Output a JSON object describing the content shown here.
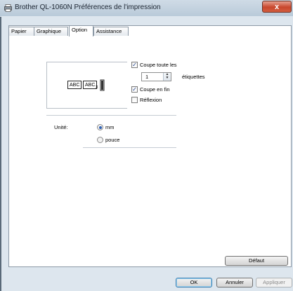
{
  "window": {
    "title": "Brother QL-1060N Préférences de l'impression",
    "close_label": "x"
  },
  "tabs": [
    {
      "label": "Papier",
      "active": false
    },
    {
      "label": "Graphique",
      "active": false
    },
    {
      "label": "Option",
      "active": true
    },
    {
      "label": "Assistance",
      "active": false
    }
  ],
  "preview": {
    "label_1": "ABC",
    "label_2": "ABC",
    "cut_mark": "x"
  },
  "options": {
    "cut_every": {
      "label": "Coupe toute les",
      "checked": true
    },
    "cut_count": "1",
    "cut_unit": "étiquettes",
    "cut_at_end": {
      "label": "Coupe en fin",
      "checked": true
    },
    "mirror": {
      "label": "Réflexion",
      "checked": false
    }
  },
  "unit": {
    "label": "Unité:",
    "options": [
      {
        "label": "mm",
        "selected": true
      },
      {
        "label": "pouce",
        "selected": false
      }
    ]
  },
  "buttons": {
    "default": "Défaut",
    "ok": "OK",
    "cancel": "Annuler",
    "apply": "Appliquer"
  },
  "colors": {
    "window_frame": "#dde6ee",
    "close_button": "#c8472d",
    "radio_dot": "#2d5fb3"
  }
}
